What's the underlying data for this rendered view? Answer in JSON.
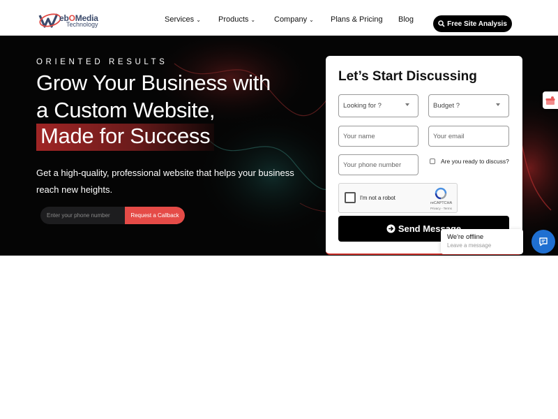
{
  "header": {
    "logo": {
      "brand_prefix": "eb",
      "brand_o": "O",
      "brand_media": "Media",
      "tagline": "Technology"
    },
    "nav": [
      {
        "label": "Services",
        "has_dropdown": true
      },
      {
        "label": "Products",
        "has_dropdown": true
      },
      {
        "label": "Company",
        "has_dropdown": true
      },
      {
        "label": "Plans & Pricing",
        "has_dropdown": false
      },
      {
        "label": "Blog",
        "has_dropdown": false
      }
    ],
    "cta_label": "Free Site Analysis"
  },
  "hero": {
    "eyebrow": "ORIENTED RESULTS",
    "headline_1": "Grow Your Business with",
    "headline_2": "a Custom Website,",
    "headline_3": "Made for Success",
    "lede": "Get a high-quality, professional website that helps your business reach new heights.",
    "phone_placeholder": "Enter your phone number",
    "callback_label": "Request a Callback"
  },
  "form": {
    "title": "Let’s Start Discussing",
    "looking_for": "Looking for ?",
    "budget": "Budget ?",
    "name_placeholder": "Your name",
    "email_placeholder": "Your email",
    "phone_placeholder": "Your phone number",
    "ready_label": "Are you ready to discuss?",
    "captcha_label": "I'm not a robot",
    "captcha_brand": "reCAPTCHA",
    "captcha_links": "Privacy - Terms",
    "send_label": "Send Message"
  },
  "chat": {
    "status": "We're offline",
    "subtitle": "Leave a message"
  },
  "colors": {
    "accent": "#e54b47",
    "hero_bg": "#050505",
    "chat_blue": "#1f6fd1"
  }
}
